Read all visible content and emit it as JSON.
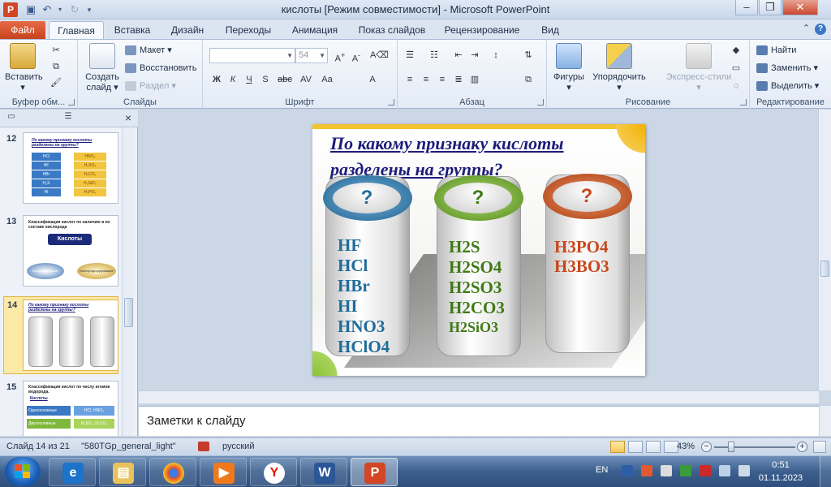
{
  "window": {
    "title": "кислоты [Режим совместимости]  -  Microsoft PowerPoint",
    "app_icon_letter": "P"
  },
  "tabs": [
    "Файл",
    "Главная",
    "Вставка",
    "Дизайн",
    "Переходы",
    "Анимация",
    "Показ слайдов",
    "Рецензирование",
    "Вид"
  ],
  "ribbon": {
    "clipboard": {
      "paste": "Вставить",
      "group": "Буфер обм..."
    },
    "slides": {
      "new_slide_1": "Создать",
      "new_slide_2": "слайд",
      "layout": "Макет",
      "reset": "Восстановить",
      "section": "Раздел",
      "group": "Слайды"
    },
    "font": {
      "font_name": "",
      "font_size": "54",
      "group": "Шрифт"
    },
    "paragraph": {
      "group": "Абзац"
    },
    "drawing": {
      "shapes": "Фигуры",
      "arrange": "Упорядочить",
      "quick_styles": "Экспресс-стили",
      "group": "Рисование"
    },
    "editing": {
      "find": "Найти",
      "replace": "Заменить",
      "select": "Выделить",
      "group": "Редактирование"
    }
  },
  "thumbnails": [
    {
      "num": "12",
      "title": "По какому признаку кислоты разделены на группы?",
      "left": [
        "HCl",
        "HF",
        "HBr",
        "H₂S",
        "HI"
      ],
      "right": [
        "HNO₃",
        "H₂SO₄",
        "H₂CO₃",
        "H₂SiO₃",
        "H₃PO₄"
      ]
    },
    {
      "num": "13",
      "title": "Классификация кислот по наличию в их составе кислорода",
      "center": "Кислоты",
      "left": "Бескислородные",
      "right": "Кислородсодержащие"
    },
    {
      "num": "14",
      "title": "По какому признаку кислоты разделены на группы?",
      "selected": true
    },
    {
      "num": "15",
      "title": "Классификация кислот по числу атомов водорода.",
      "sub": "Кислоты",
      "row1": "Одноосновные",
      "row1v": "HCl, HNO₃",
      "row2": "Двухосновные",
      "row2v": "H₂SO₄, H₂CO₃"
    }
  ],
  "slide": {
    "title_line1": "По какому признаку кислоты",
    "title_line2": "разделены на группы?",
    "columns": [
      {
        "mark": "?",
        "color": "#1f6c9a",
        "ring": "#2b7fb0",
        "items": [
          "HF",
          "HCl",
          "HBr",
          "HI",
          "HNO3",
          "HClO4"
        ]
      },
      {
        "mark": "?",
        "color": "#3f7a16",
        "ring": "#6ea82a",
        "items": [
          "H2S",
          "H2SO4",
          "H2SO3",
          "H2CO3",
          "H2SiO3"
        ]
      },
      {
        "mark": "?",
        "color": "#c8471a",
        "ring": "#c94a17",
        "items": [
          "H3PO4",
          "H3BO3"
        ]
      }
    ]
  },
  "notes": {
    "placeholder": "Заметки к слайду"
  },
  "status": {
    "slide_counter": "Слайд 14 из 21",
    "theme": "\"580TGp_general_light\"",
    "language": "русский",
    "zoom": "43%"
  },
  "taskbar": {
    "lang": "EN",
    "time": "0:51",
    "date": "01.11.2023"
  },
  "colors": {
    "accent": "#c8421f",
    "ribbon_bg": "#e3ebf6",
    "title_blue": "#1c1c7a"
  }
}
